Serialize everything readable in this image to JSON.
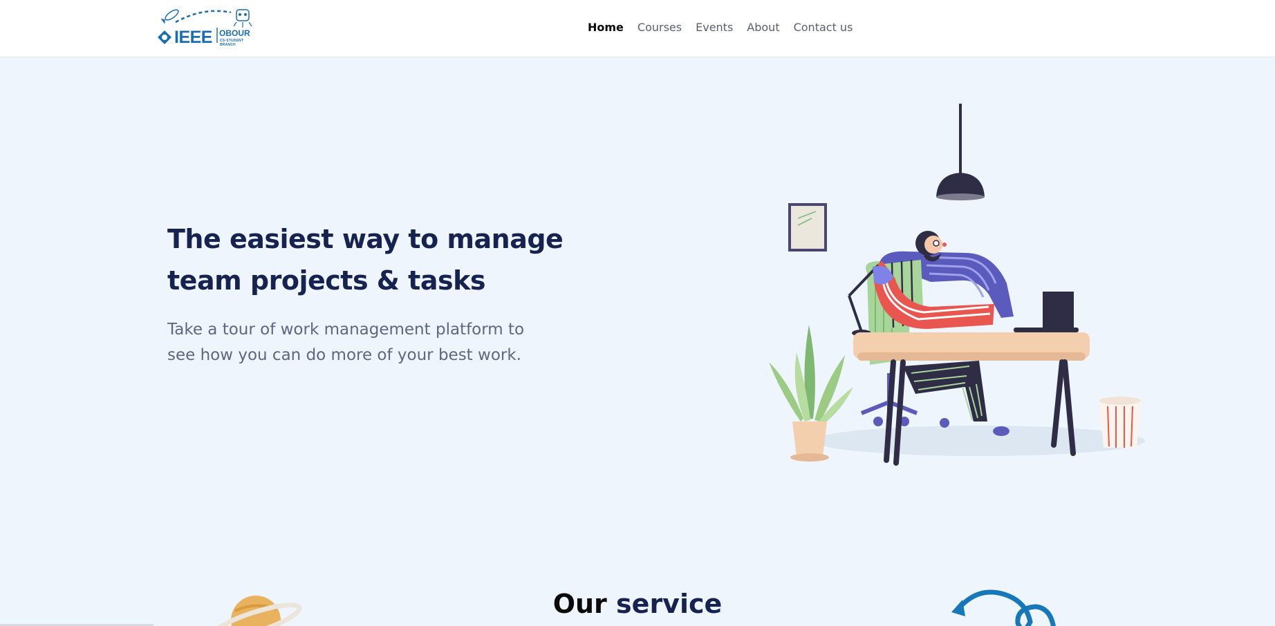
{
  "brand": {
    "logo_text": "IEEE",
    "logo_sub": "OBOUR",
    "logo_sub2": "CS-STUDENT BRANCH"
  },
  "nav": {
    "items": [
      {
        "label": "Home",
        "active": true
      },
      {
        "label": "Courses",
        "active": false
      },
      {
        "label": "Events",
        "active": false
      },
      {
        "label": "About",
        "active": false
      },
      {
        "label": "Contact us",
        "active": false
      }
    ]
  },
  "hero": {
    "title_line1": "The easiest way to manage",
    "title_line2": "team projects & tasks",
    "subtitle_line1": "Take a tour of work management platform to",
    "subtitle_line2": "see how you can do more of your best work."
  },
  "services": {
    "title_dark": "Our",
    "title_accent": "service"
  },
  "colors": {
    "background": "#eef5fd",
    "heading": "#16224f",
    "body_text": "#5e6682",
    "brand_blue": "#1a6db5"
  },
  "icons": {
    "logo": "ieee-rocket-logo-icon",
    "hero": "desk-worker-illustration",
    "planet": "planet-icon",
    "swirl": "arrow-swirl-icon"
  }
}
